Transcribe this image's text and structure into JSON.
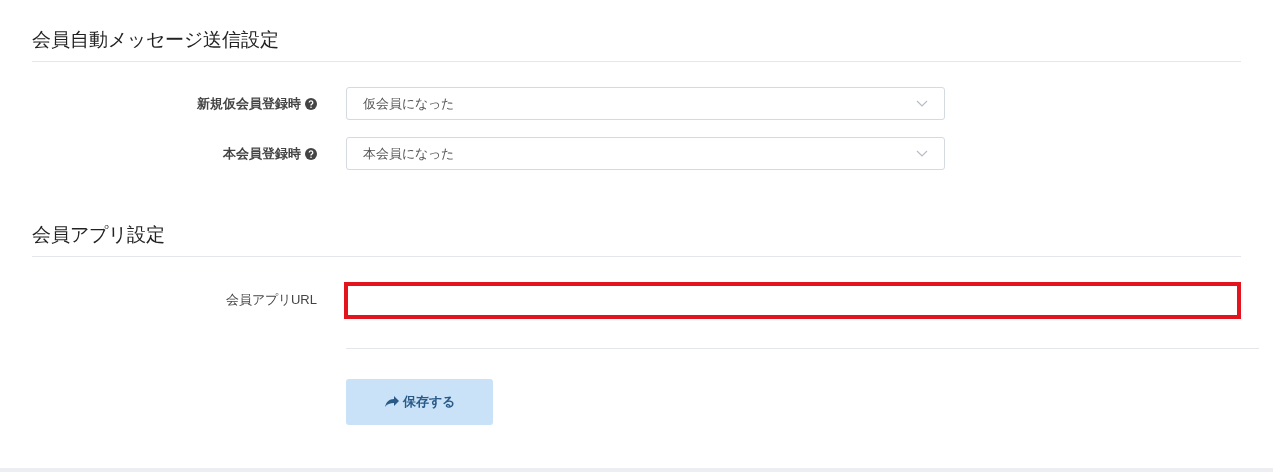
{
  "sections": [
    {
      "title": "会員自動メッセージ送信設定",
      "fields": [
        {
          "kind": "select",
          "label": "新規仮会員登録時",
          "help": true,
          "value": "仮会員になった"
        },
        {
          "kind": "select",
          "label": "本会員登録時",
          "help": true,
          "value": "本会員になった"
        }
      ]
    },
    {
      "title": "会員アプリ設定",
      "fields": [
        {
          "kind": "input",
          "label": "会員アプリURL",
          "help": false,
          "highlighted": true
        }
      ]
    }
  ],
  "save_button": {
    "label": "保存する"
  }
}
